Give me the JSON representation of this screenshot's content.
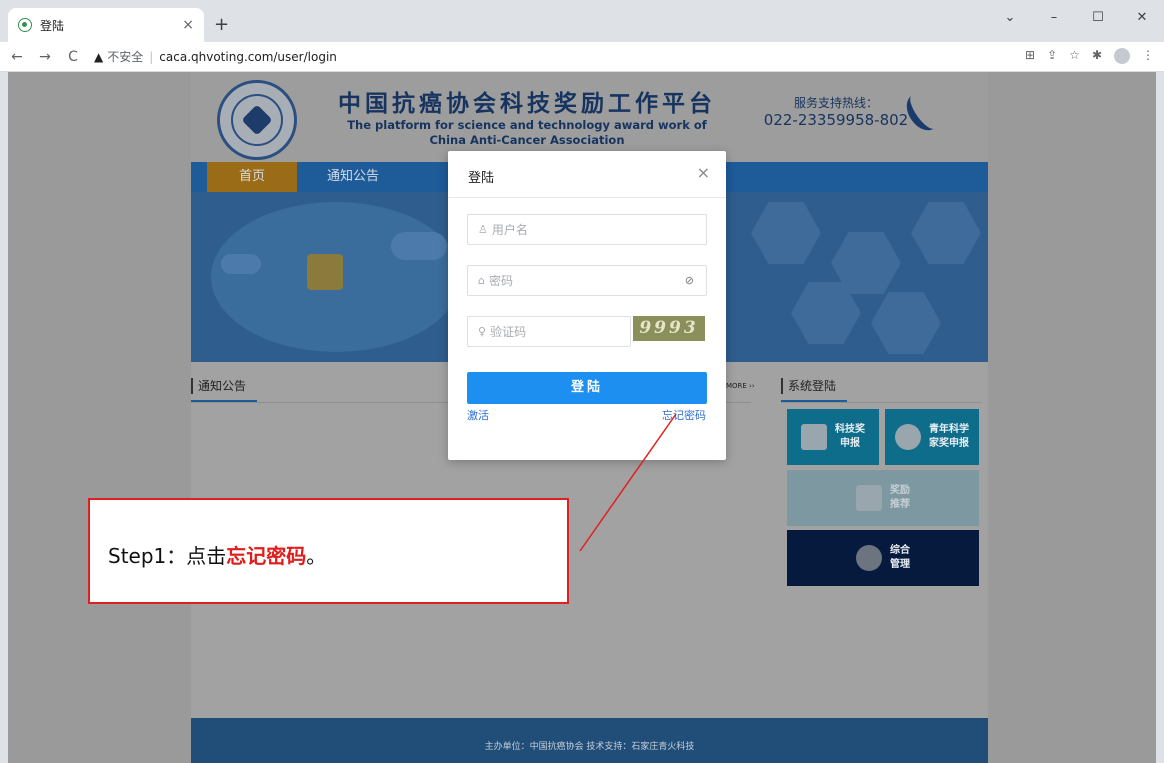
{
  "browser": {
    "tab_title": "登陆",
    "tab_close": "×",
    "new_tab": "+",
    "win_controls": [
      "⌄",
      "–",
      "☐",
      "✕"
    ],
    "url": "caca.qhvoting.com/user/login",
    "insecure_label": "不安全",
    "nav": {
      "back": "←",
      "forward": "→",
      "reload": "C"
    },
    "toolbar_icons": [
      "translate-icon",
      "share-icon",
      "star-icon",
      "puzzle-icon",
      "profile-icon",
      "menu-icon"
    ]
  },
  "site": {
    "title_cn": "中国抗癌协会科技奖励工作平台",
    "title_en_line1": "The platform for science and technology award work of",
    "title_en_line2": "China Anti-Cancer Association",
    "hotline_label": "服务支持热线：",
    "hotline_number": "022-23359958-802",
    "nav": {
      "home": "首页",
      "notice": "通知公告"
    },
    "section_notice": "通知公告",
    "more_link": "MORE ››",
    "section_login": "系统登陆",
    "tiles": {
      "tech_award": "科技奖\n申报",
      "young_scientist": "青年科学\n家奖申报",
      "award_recommend": "奖励\n推荐",
      "management": "综合\n管理"
    },
    "footer": "主办单位：中国抗癌协会    技术支持：石家庄青火科技"
  },
  "modal": {
    "title": "登陆",
    "close": "×",
    "username_placeholder": "用户名",
    "password_placeholder": "密码",
    "captcha_placeholder": "验证码",
    "captcha_value": "9993",
    "login_button": "登陆",
    "activate_link": "激活",
    "forgot_link": "忘记密码"
  },
  "annotation": {
    "step_prefix": "Step1：点击",
    "step_highlight": "忘记密码",
    "step_suffix": "。"
  },
  "colors": {
    "accent_blue": "#1c8ff0",
    "annotation_red": "#e02020"
  }
}
